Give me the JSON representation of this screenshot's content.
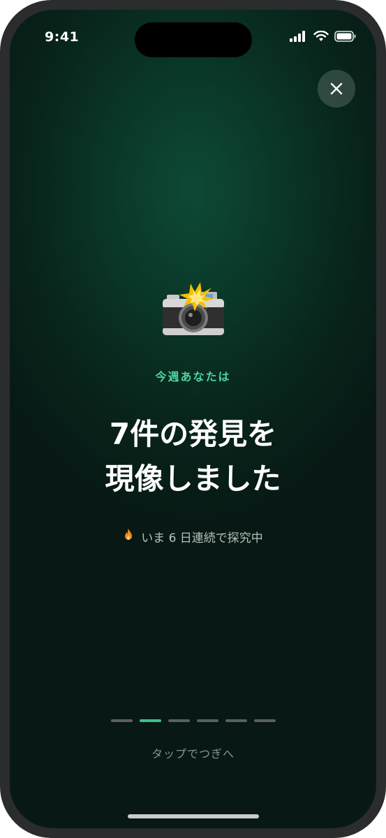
{
  "status_bar": {
    "time": "9:41",
    "icons": [
      "cellular-signal-icon",
      "wifi-icon",
      "battery-icon"
    ]
  },
  "close_button": {
    "icon": "close-icon"
  },
  "hero": {
    "icon": "camera-with-flash-icon",
    "eyebrow": "今週あなたは",
    "headline_line1": "7件の発見を",
    "headline_line2": "現像しました"
  },
  "streak": {
    "icon": "fire-icon",
    "text": "いま 6 日連続で探究中"
  },
  "progress": {
    "total_segments": 6,
    "active_index": 1
  },
  "tap_hint": "タップでつぎへ",
  "colors": {
    "accent": "#3fbf8c",
    "eyebrow": "#4fd4a0",
    "background": "#0a3526"
  }
}
